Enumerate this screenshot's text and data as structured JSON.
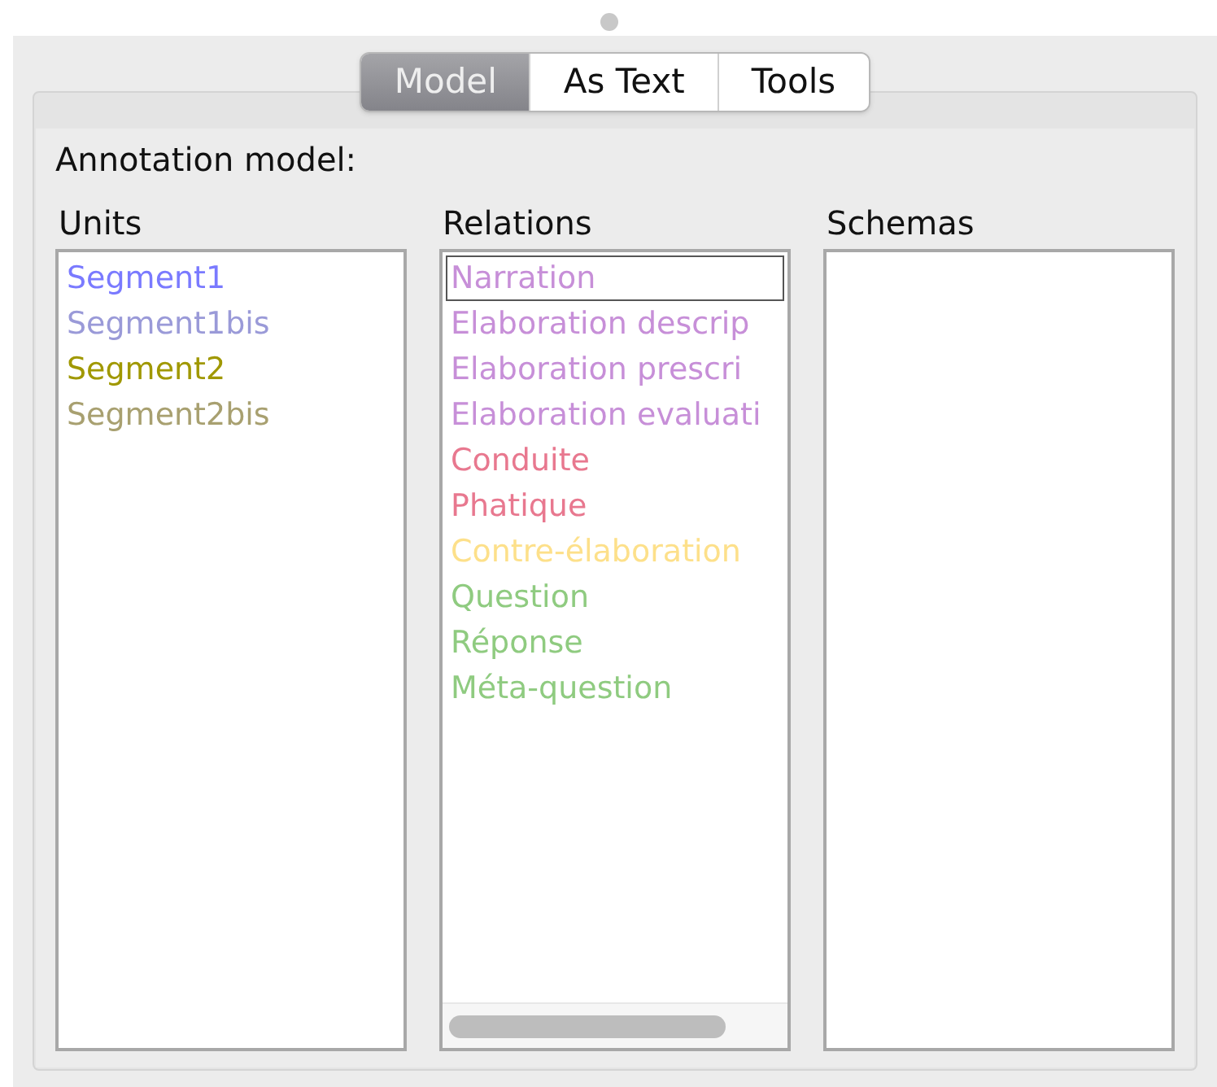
{
  "tabs": [
    {
      "label": "Model",
      "selected": true
    },
    {
      "label": "As Text",
      "selected": false
    },
    {
      "label": "Tools",
      "selected": false
    }
  ],
  "heading": "Annotation model:",
  "units": {
    "title": "Units",
    "items": [
      {
        "label": "Segment1",
        "color": "#7a7aff"
      },
      {
        "label": "Segment1bis",
        "color": "#9a9ad8"
      },
      {
        "label": "Segment2",
        "color": "#a09800"
      },
      {
        "label": "Segment2bis",
        "color": "#a8a070"
      }
    ]
  },
  "relations": {
    "title": "Relations",
    "items": [
      {
        "label": "Narration",
        "color": "#c78fd8",
        "focused": true
      },
      {
        "label": "Elaboration descrip",
        "color": "#c78fd8",
        "focused": false
      },
      {
        "label": "Elaboration prescri",
        "color": "#c78fd8",
        "focused": false
      },
      {
        "label": "Elaboration evaluati",
        "color": "#c78fd8",
        "focused": false
      },
      {
        "label": "Conduite",
        "color": "#e8788f",
        "focused": false
      },
      {
        "label": "Phatique",
        "color": "#e8788f",
        "focused": false
      },
      {
        "label": "Contre-élaboration",
        "color": "#fde08a",
        "focused": false
      },
      {
        "label": "Question",
        "color": "#8fcb80",
        "focused": false
      },
      {
        "label": "Réponse",
        "color": "#8fcb80",
        "focused": false
      },
      {
        "label": "Méta-question",
        "color": "#8fcb80",
        "focused": false
      }
    ]
  },
  "schemas": {
    "title": "Schemas"
  }
}
